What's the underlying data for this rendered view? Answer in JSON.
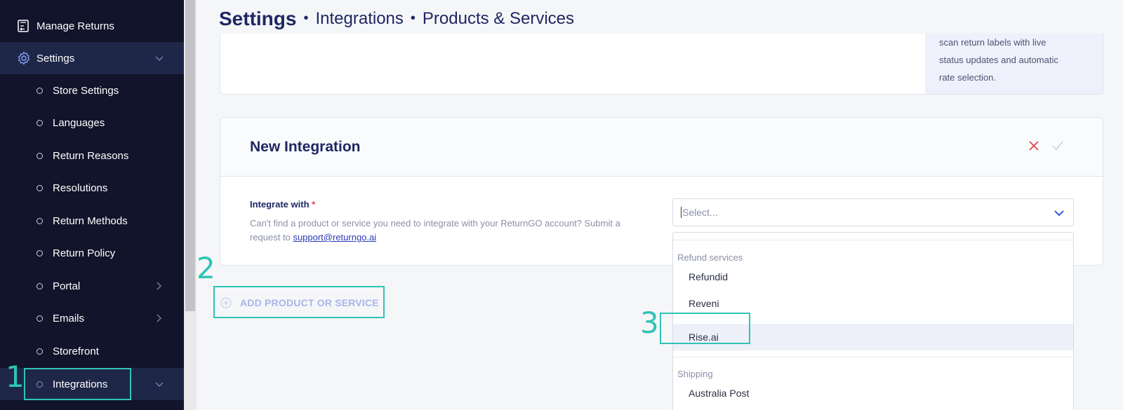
{
  "sidebar": {
    "manage_returns": "Manage Returns",
    "settings": "Settings",
    "items": [
      {
        "label": "Store Settings",
        "has_arrow": false
      },
      {
        "label": "Languages",
        "has_arrow": false
      },
      {
        "label": "Return Reasons",
        "has_arrow": false
      },
      {
        "label": "Resolutions",
        "has_arrow": false
      },
      {
        "label": "Return Methods",
        "has_arrow": false
      },
      {
        "label": "Return Policy",
        "has_arrow": false
      },
      {
        "label": "Portal",
        "has_arrow": true
      },
      {
        "label": "Emails",
        "has_arrow": true
      },
      {
        "label": "Storefront",
        "has_arrow": false
      },
      {
        "label": "Integrations",
        "has_arrow": false,
        "active": true
      }
    ]
  },
  "header": {
    "title": "Settings",
    "crumb1": "Integrations",
    "crumb2": "Products & Services",
    "separator": "•"
  },
  "top_card": {
    "side_text_1": "scan return labels with live",
    "side_text_2": "status updates and automatic",
    "side_text_3": "rate selection."
  },
  "new_integration": {
    "title": "New Integration",
    "field_label": "Integrate with",
    "required_mark": "*",
    "help_text": "Can't find a product or service you need to integrate with your ReturnGO account? Submit a request to ",
    "help_link": "support@returngo.ai",
    "select_placeholder": "Select..."
  },
  "dropdown": {
    "groups": [
      {
        "label": "Refund services",
        "options": [
          "Refundid",
          "Reveni",
          "Rise.ai"
        ]
      },
      {
        "label": "Shipping",
        "options": [
          "Australia Post"
        ]
      }
    ],
    "highlighted": "Rise.ai"
  },
  "add_button": "ADD PRODUCT OR SERVICE",
  "annotations": [
    "1",
    "2",
    "3"
  ],
  "colors": {
    "sidebar_bg": "#11142a",
    "sidebar_active": "#1f2748",
    "brand_text": "#1d2863",
    "annotation": "#2ec4b6",
    "close": "#e0444b"
  }
}
